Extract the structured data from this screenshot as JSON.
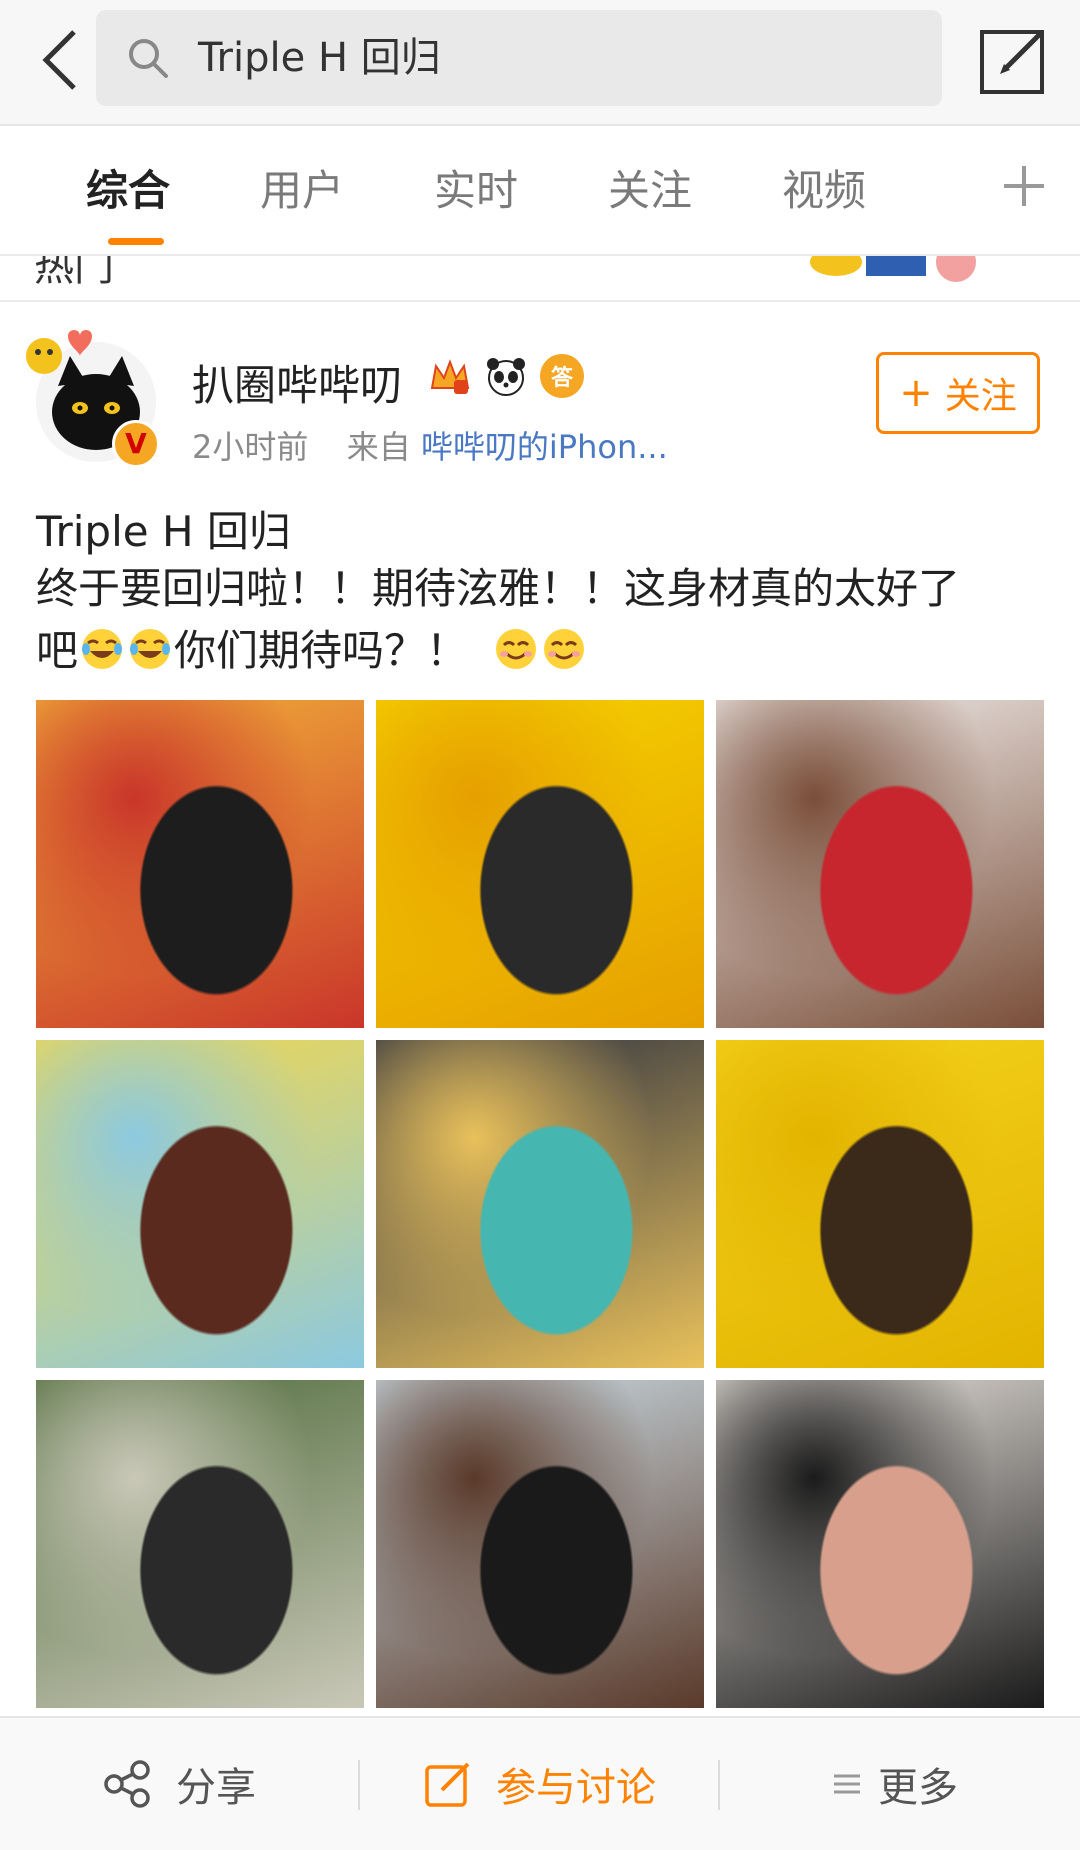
{
  "search": {
    "query": "Triple H 回归"
  },
  "tabs": [
    {
      "label": "综合"
    },
    {
      "label": "用户"
    },
    {
      "label": "实时"
    },
    {
      "label": "关注"
    },
    {
      "label": "视频"
    }
  ],
  "strip": {
    "partial_text": "热门"
  },
  "post": {
    "username": "扒圈哔哔叨",
    "time": "2小时前",
    "from_prefix": "来自",
    "source": "哔哔叨的iPhon...",
    "follow_label": "关注",
    "badges": [
      "crown-vip-badge",
      "panda-badge",
      "answer-badge"
    ],
    "badge_answer_text": "答",
    "verified_text": "V",
    "title": "Triple H 回归",
    "body_line1": "终于要回归啦！！期待泫雅！！这身材真的太好了",
    "body_line2_pre": "吧",
    "body_line2_mid": "你们期待吗？！",
    "images": [
      {
        "name": "photo-1",
        "colors": [
          "#f2b23a",
          "#c9362a",
          "#1d1d1d"
        ]
      },
      {
        "name": "photo-2",
        "colors": [
          "#f5d200",
          "#e6a000",
          "#2a2a2a"
        ]
      },
      {
        "name": "photo-3",
        "colors": [
          "#f3f0ee",
          "#7a4f3a",
          "#c7262f"
        ]
      },
      {
        "name": "photo-4",
        "colors": [
          "#f4d84a",
          "#8cc9e0",
          "#5a2a1f"
        ]
      },
      {
        "name": "photo-5",
        "colors": [
          "#2b3040",
          "#e9c15b",
          "#46b6b0"
        ]
      },
      {
        "name": "photo-6",
        "colors": [
          "#f4d21c",
          "#e2b400",
          "#3b2a1a"
        ]
      },
      {
        "name": "photo-7",
        "colors": [
          "#4f6b3b",
          "#c9c8b8",
          "#2a2a2a"
        ]
      },
      {
        "name": "photo-8",
        "colors": [
          "#cfe1ea",
          "#5a3a2a",
          "#1a1a1a"
        ]
      },
      {
        "name": "photo-9",
        "colors": [
          "#ece6e0",
          "#1b1b1b",
          "#d8a08c"
        ]
      }
    ]
  },
  "actions": {
    "share": "分享",
    "discuss": "参与讨论",
    "more": "更多"
  },
  "colors": {
    "accent": "#ff8200",
    "link": "#4a78c2"
  }
}
